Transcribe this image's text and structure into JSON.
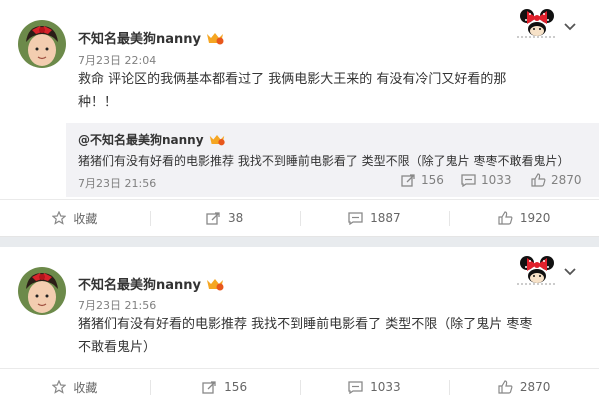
{
  "colors": {
    "page_bg": "#e8ebee",
    "card_bg": "#ffffff",
    "repost_bg": "#f2f2f5",
    "muted": "#808080",
    "vip_gold": "#f5a623"
  },
  "post1": {
    "nickname": "不知名最美狗nanny",
    "time": "7月23日 22:04",
    "text_line1": "救命 评论区的我俩基本都看过了 我俩电影大王来的 有没有冷门又好看的那",
    "text_line2": "种！！",
    "repost": {
      "nickname": "@不知名最美狗nanny",
      "text": "猪猪们有没有好看的电影推荐 我找不到睡前电影看了 类型不限（除了鬼片 枣枣不敢看鬼片）",
      "time": "7月23日 21:56",
      "reposts": "156",
      "comments": "1033",
      "likes": "2870"
    },
    "actions": {
      "favorite": "收藏",
      "reposts": "38",
      "comments": "1887",
      "likes": "1920"
    }
  },
  "post2": {
    "nickname": "不知名最美狗nanny",
    "time": "7月23日 21:56",
    "text_line1": "猪猪们有没有好看的电影推荐 我找不到睡前电影看了 类型不限（除了鬼片 枣枣",
    "text_line2": "不敢看鬼片）",
    "actions": {
      "favorite": "收藏",
      "reposts": "156",
      "comments": "1033",
      "likes": "2870"
    }
  }
}
